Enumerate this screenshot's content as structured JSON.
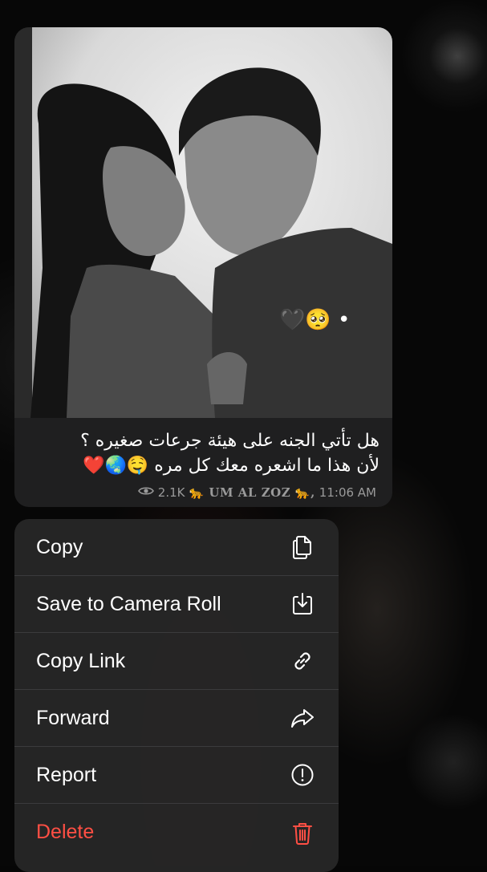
{
  "message": {
    "emoji_line": "🖤🥺 •",
    "caption_line1": "هل تأتي الجنه على هيئة جرعات صغيره ؟",
    "caption_line2": "لأن هذا ما اشعره معك كل مره 🤤🌏❤️",
    "views": "2.1K",
    "signature": "🐆 𝐔𝐌 𝐀𝐋 𝐙𝐎𝐙 🐆,",
    "time": "11:06 AM"
  },
  "menu": {
    "items": [
      {
        "label": "Copy",
        "icon": "copy-icon"
      },
      {
        "label": "Save to Camera Roll",
        "icon": "save-icon"
      },
      {
        "label": "Copy Link",
        "icon": "link-icon"
      },
      {
        "label": "Forward",
        "icon": "forward-icon"
      },
      {
        "label": "Report",
        "icon": "report-icon"
      },
      {
        "label": "Delete",
        "icon": "trash-icon",
        "color": "#ff4f44"
      }
    ]
  }
}
